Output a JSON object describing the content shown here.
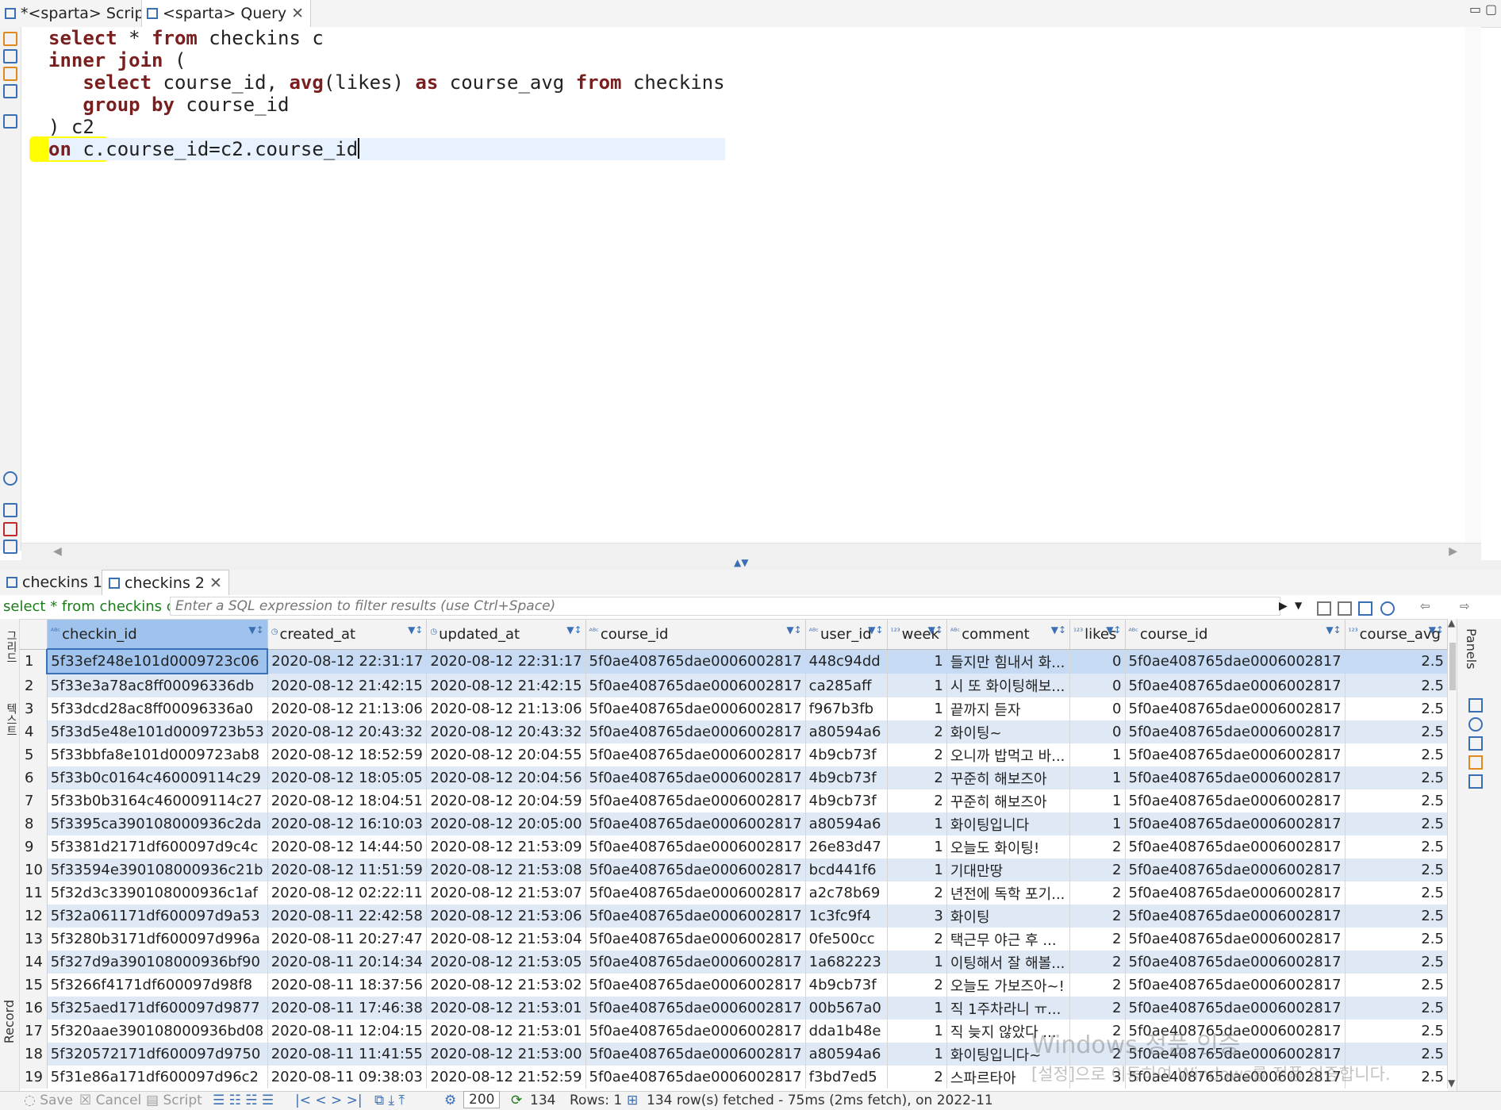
{
  "editor_tabs": [
    {
      "label": "*<sparta> Script",
      "active": false
    },
    {
      "label": "<sparta> Query",
      "active": true
    }
  ],
  "sql_lines": [
    {
      "indent": "",
      "tokens": [
        {
          "t": "select",
          "kw": true
        },
        {
          "t": " * ",
          "kw": false
        },
        {
          "t": "from",
          "kw": true
        },
        {
          "t": " checkins c",
          "kw": false
        }
      ]
    },
    {
      "indent": "",
      "tokens": [
        {
          "t": "inner join",
          "kw": true
        },
        {
          "t": " (",
          "kw": false
        }
      ]
    },
    {
      "indent": "   ",
      "tokens": [
        {
          "t": "select",
          "kw": true
        },
        {
          "t": " course_id, ",
          "kw": false
        },
        {
          "t": "avg",
          "kw": true
        },
        {
          "t": "(likes) ",
          "kw": false
        },
        {
          "t": "as",
          "kw": true
        },
        {
          "t": " course_avg ",
          "kw": false
        },
        {
          "t": "from",
          "kw": true
        },
        {
          "t": " checkins",
          "kw": false
        }
      ]
    },
    {
      "indent": "   ",
      "tokens": [
        {
          "t": "group by",
          "kw": true
        },
        {
          "t": " course_id",
          "kw": false
        }
      ]
    },
    {
      "indent": "",
      "tokens": [
        {
          "t": ") c2",
          "kw": false
        }
      ]
    },
    {
      "indent": "",
      "tokens": [
        {
          "t": "on",
          "kw": true
        },
        {
          "t": " c.course_id=c2.course_id",
          "kw": false
        }
      ]
    }
  ],
  "result_tabs": [
    {
      "label": "checkins 1",
      "active": false
    },
    {
      "label": "checkins 2",
      "active": true
    }
  ],
  "filter": {
    "query_text": "select * from checkins c",
    "placeholder": "Enter a SQL expression to filter results (use Ctrl+Space)"
  },
  "columns": [
    {
      "name": "checkin_id",
      "type": "ABC"
    },
    {
      "name": "created_at",
      "type": "clock"
    },
    {
      "name": "updated_at",
      "type": "clock"
    },
    {
      "name": "course_id",
      "type": "ABC"
    },
    {
      "name": "user_id",
      "type": "ABC"
    },
    {
      "name": "week",
      "type": "123"
    },
    {
      "name": "comment",
      "type": "ABC"
    },
    {
      "name": "likes",
      "type": "123"
    },
    {
      "name": "course_id",
      "type": "ABC"
    },
    {
      "name": "course_avg",
      "type": "123"
    }
  ],
  "rows": [
    [
      "1",
      "5f33ef248e101d0009723c06",
      "2020-08-12 22:31:17",
      "2020-08-12 22:31:17",
      "5f0ae408765dae0006002817",
      "448c94dd",
      "1",
      "들지만 힘내서 화...",
      "0",
      "5f0ae408765dae0006002817",
      "2.5"
    ],
    [
      "2",
      "5f33e3a78ac8ff00096336db",
      "2020-08-12 21:42:15",
      "2020-08-12 21:42:15",
      "5f0ae408765dae0006002817",
      "ca285aff",
      "1",
      "시 또 화이팅해보...",
      "0",
      "5f0ae408765dae0006002817",
      "2.5"
    ],
    [
      "3",
      "5f33dcd28ac8ff00096336a0",
      "2020-08-12 21:13:06",
      "2020-08-12 21:13:06",
      "5f0ae408765dae0006002817",
      "f967b3fb",
      "1",
      "끝까지 듣자",
      "0",
      "5f0ae408765dae0006002817",
      "2.5"
    ],
    [
      "4",
      "5f33d5e48e101d0009723b53",
      "2020-08-12 20:43:32",
      "2020-08-12 20:43:32",
      "5f0ae408765dae0006002817",
      "a80594a6",
      "2",
      "화이팅~",
      "0",
      "5f0ae408765dae0006002817",
      "2.5"
    ],
    [
      "5",
      "5f33bbfa8e101d0009723ab8",
      "2020-08-12 18:52:59",
      "2020-08-12 20:04:55",
      "5f0ae408765dae0006002817",
      "4b9cb73f",
      "2",
      "오니까 밥먹고 바...",
      "1",
      "5f0ae408765dae0006002817",
      "2.5"
    ],
    [
      "6",
      "5f33b0c0164c460009114c29",
      "2020-08-12 18:05:05",
      "2020-08-12 20:04:56",
      "5f0ae408765dae0006002817",
      "4b9cb73f",
      "2",
      "꾸준히 해보즈아",
      "1",
      "5f0ae408765dae0006002817",
      "2.5"
    ],
    [
      "7",
      "5f33b0b3164c460009114c27",
      "2020-08-12 18:04:51",
      "2020-08-12 20:04:59",
      "5f0ae408765dae0006002817",
      "4b9cb73f",
      "2",
      "꾸준히 해보즈아",
      "1",
      "5f0ae408765dae0006002817",
      "2.5"
    ],
    [
      "8",
      "5f3395ca390108000936c2da",
      "2020-08-12 16:10:03",
      "2020-08-12 20:05:00",
      "5f0ae408765dae0006002817",
      "a80594a6",
      "1",
      "화이팅입니다",
      "1",
      "5f0ae408765dae0006002817",
      "2.5"
    ],
    [
      "9",
      "5f3381d2171df600097d9c4c",
      "2020-08-12 14:44:50",
      "2020-08-12 21:53:09",
      "5f0ae408765dae0006002817",
      "26e83d47",
      "1",
      "오늘도 화이팅!",
      "2",
      "5f0ae408765dae0006002817",
      "2.5"
    ],
    [
      "10",
      "5f33594e390108000936c21b",
      "2020-08-12 11:51:59",
      "2020-08-12 21:53:08",
      "5f0ae408765dae0006002817",
      "bcd441f6",
      "1",
      "기대만땅",
      "2",
      "5f0ae408765dae0006002817",
      "2.5"
    ],
    [
      "11",
      "5f32d3c3390108000936c1af",
      "2020-08-12 02:22:11",
      "2020-08-12 21:53:07",
      "5f0ae408765dae0006002817",
      "a2c78b69",
      "2",
      "년전에 독학 포기...",
      "2",
      "5f0ae408765dae0006002817",
      "2.5"
    ],
    [
      "12",
      "5f32a061171df600097d9a53",
      "2020-08-11 22:42:58",
      "2020-08-12 21:53:06",
      "5f0ae408765dae0006002817",
      "1c3fc9f4",
      "3",
      "화이팅",
      "2",
      "5f0ae408765dae0006002817",
      "2.5"
    ],
    [
      "13",
      "5f3280b3171df600097d996a",
      "2020-08-11 20:27:47",
      "2020-08-12 21:53:04",
      "5f0ae408765dae0006002817",
      "0fe500cc",
      "2",
      "택근무 야근 후 ...",
      "2",
      "5f0ae408765dae0006002817",
      "2.5"
    ],
    [
      "14",
      "5f327d9a390108000936bf90",
      "2020-08-11 20:14:34",
      "2020-08-12 21:53:05",
      "5f0ae408765dae0006002817",
      "1a682223",
      "1",
      "이팅해서 잘 해볼...",
      "2",
      "5f0ae408765dae0006002817",
      "2.5"
    ],
    [
      "15",
      "5f3266f4171df600097d98f8",
      "2020-08-11 18:37:56",
      "2020-08-12 21:53:02",
      "5f0ae408765dae0006002817",
      "4b9cb73f",
      "2",
      "오늘도 가보즈아~!",
      "2",
      "5f0ae408765dae0006002817",
      "2.5"
    ],
    [
      "16",
      "5f325aed171df600097d9877",
      "2020-08-11 17:46:38",
      "2020-08-12 21:53:01",
      "5f0ae408765dae0006002817",
      "00b567a0",
      "1",
      "직 1주차라니 ㅠ...",
      "2",
      "5f0ae408765dae0006002817",
      "2.5"
    ],
    [
      "17",
      "5f320aae390108000936bd08",
      "2020-08-11 12:04:15",
      "2020-08-12 21:53:01",
      "5f0ae408765dae0006002817",
      "dda1b48e",
      "1",
      "직 늦지 않았다 ...",
      "2",
      "5f0ae408765dae0006002817",
      "2.5"
    ],
    [
      "18",
      "5f320572171df600097d9750",
      "2020-08-11 11:41:55",
      "2020-08-12 21:53:00",
      "5f0ae408765dae0006002817",
      "a80594a6",
      "1",
      "화이팅입니다~",
      "2",
      "5f0ae408765dae0006002817",
      "2.5"
    ],
    [
      "19",
      "5f31e86a171df600097d96c2",
      "2020-08-11 09:38:03",
      "2020-08-12 21:52:59",
      "5f0ae408765dae0006002817",
      "f3bd7ed5",
      "2",
      "스파르타아",
      "3",
      "5f0ae408765dae0006002817",
      "2.5"
    ]
  ],
  "status": {
    "save": "Save",
    "cancel": "Cancel",
    "script": "Script",
    "fetch_size": "200",
    "refresh_count": "134",
    "rows_label": "Rows: 1",
    "fetched": "134 row(s) fetched - 75ms (2ms fetch), on 2022-11"
  },
  "side_labels": {
    "panels": "Panels",
    "record": "Record",
    "grid": "그리드",
    "text": "텍스트"
  },
  "watermark": {
    "line1": "Windows 정품 인증",
    "line2": "[설정]으로 이동하여 Windows를 정품 인증합니다."
  },
  "colors": {
    "keyword": "#7a1f1f",
    "highlight": "#ffff00",
    "row_alt": "#dfe9f6",
    "selection": "#9fc3ec",
    "filter_query": "#1a7d1a"
  }
}
